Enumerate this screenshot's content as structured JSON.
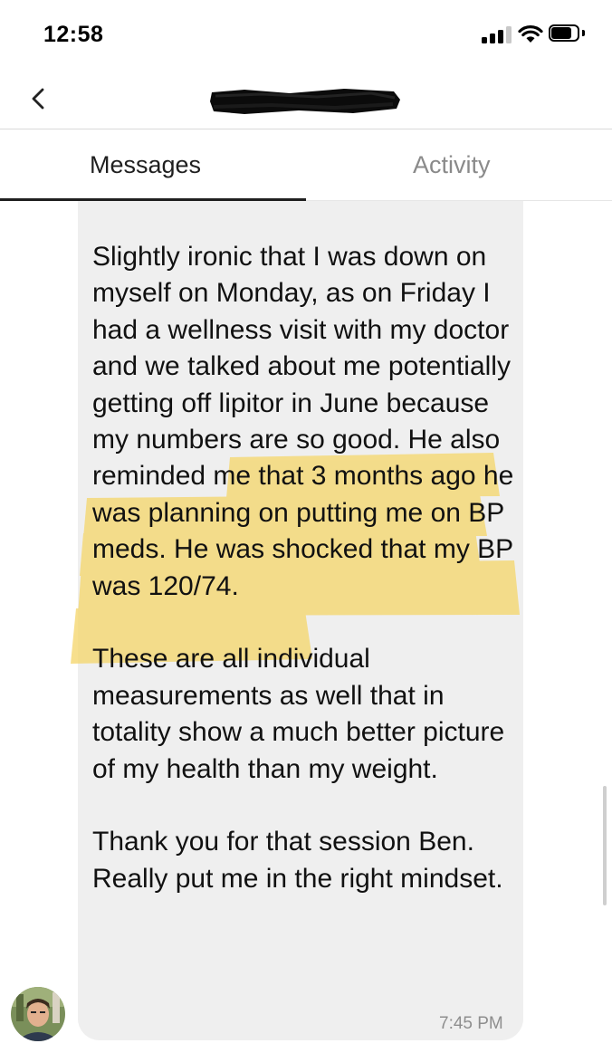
{
  "status_bar": {
    "time": "12:58"
  },
  "nav": {
    "back_icon": "chevron-left-icon",
    "contact_name": "",
    "contact_name_redacted": true
  },
  "tabs": [
    {
      "label": "Messages",
      "active": true
    },
    {
      "label": "Activity",
      "active": false
    }
  ],
  "message": {
    "paragraphs": [
      "Slightly ironic that I was down on myself on Monday, as on Friday I had a wellness visit with my doctor and we talked about me potentially getting off lipitor in June because my numbers are so good.  He also reminded me that 3 months ago he was planning on putting me on BP meds.  He was shocked that my BP was 120/74.",
      "These are all individual measurements as well that in totality show a much better picture of my health than my weight.",
      "Thank you for that session Ben. Really put me in the right mindset."
    ],
    "timestamp": "7:45 PM"
  },
  "colors": {
    "bubble": "#efefef",
    "highlight": "#f5d76e",
    "tab_active": "#1f1f1f",
    "tab_inactive": "#8a8a8a"
  }
}
